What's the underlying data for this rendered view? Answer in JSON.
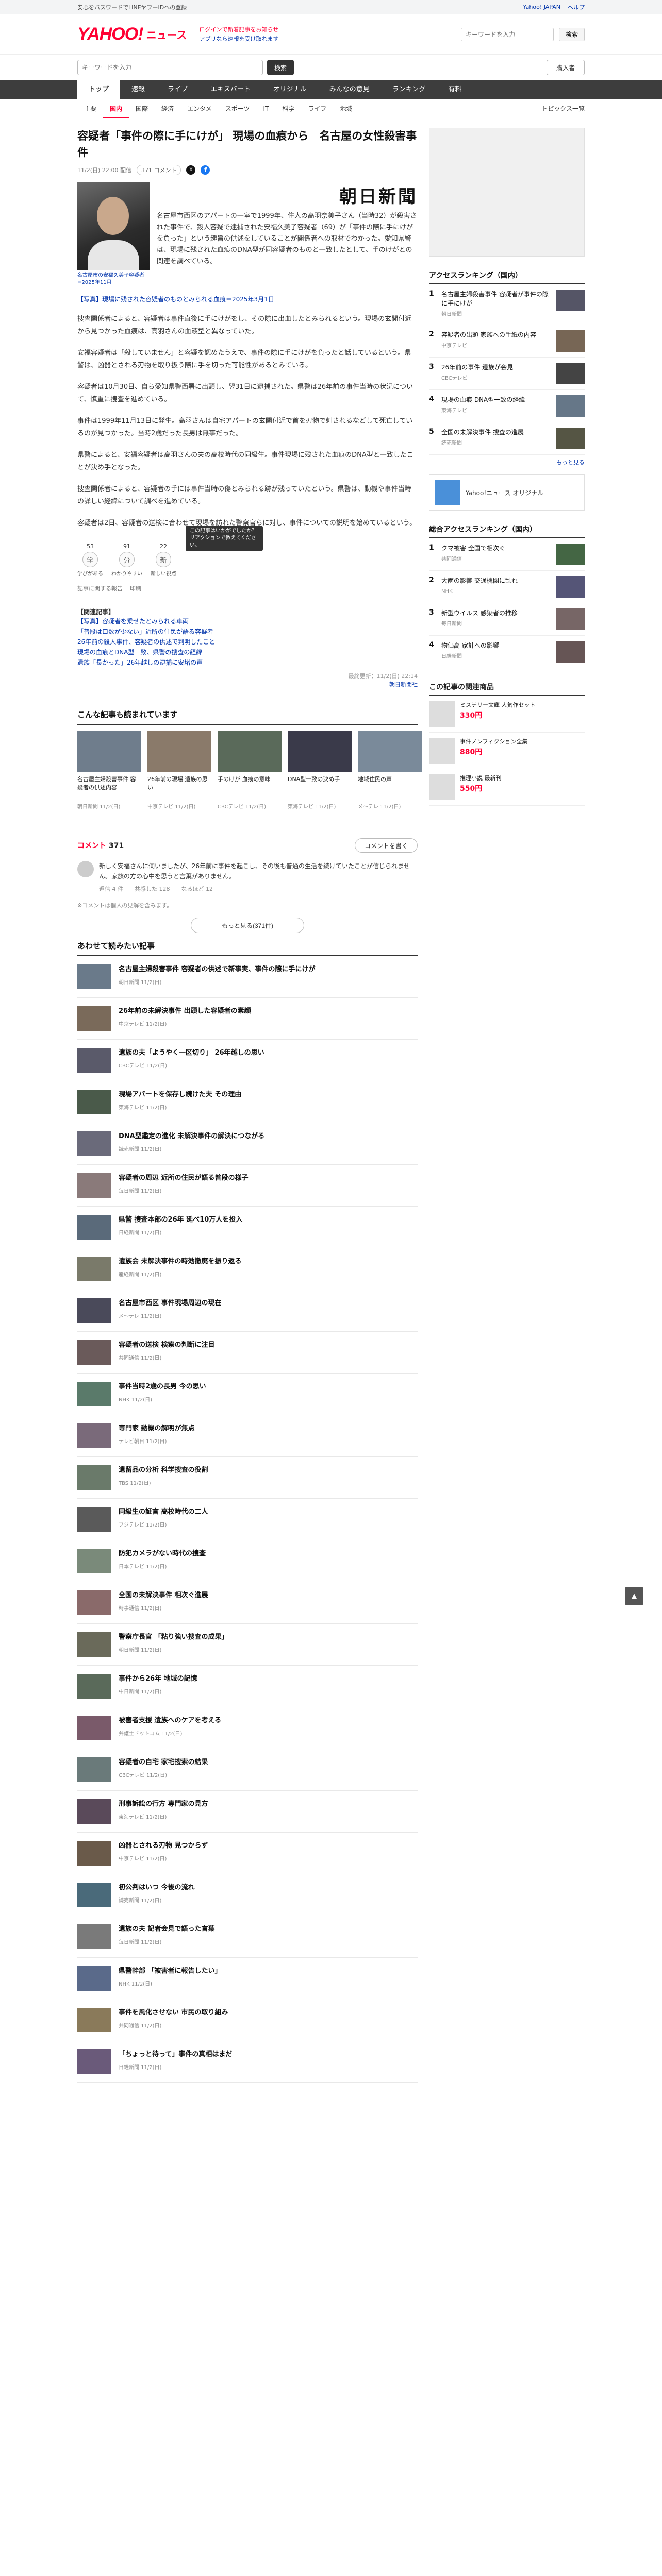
{
  "topbar": {
    "left": "安心をパスワードでLINEヤフーIDへの登録",
    "links": [
      "Yahoo! JAPAN",
      "ヘルプ"
    ]
  },
  "header": {
    "logo": "YAHOO!",
    "logo_sub": "ニュース",
    "notes": [
      "ログインで新着記事をお知らせ",
      "アプリなら速報を受け取れます"
    ],
    "search_placeholder": "キーワードを入力",
    "search_button": "検索"
  },
  "search": {
    "placeholder": "キーワードを入力",
    "button": "検索",
    "login": "購入者"
  },
  "nav": {
    "items": [
      "トップ",
      "速報",
      "ライブ",
      "エキスパート",
      "オリジナル",
      "みんなの意見",
      "ランキング",
      "有料"
    ],
    "active_index": 0,
    "right": "トピックス一覧"
  },
  "subnav": {
    "items": [
      "主要",
      "国内",
      "国際",
      "経済",
      "エンタメ",
      "スポーツ",
      "IT",
      "科学",
      "ライフ",
      "地域"
    ],
    "active_index": 1,
    "right": "トピックス一覧"
  },
  "article": {
    "headline": "容疑者「事件の際に手にけが」 現場の血痕から　名古屋の女性殺害事件",
    "date": "11/2(日) 22:00 配信",
    "comments_pill": "371 コメント",
    "paper": "朝日新聞",
    "photo_caption": "名古屋市の安福久美子容疑者=2025年11月",
    "lead": "名古屋市西区のアパートの一室で1999年、住人の高羽奈美子さん（当時32）が殺害された事件で、殺人容疑で逮捕された安福久美子容疑者（69）が「事件の際に手にけがを負った」という趣旨の供述をしていることが関係者への取材でわかった。愛知県警は、現場に残された血痕のDNA型が同容疑者のものと一致したとして、手のけがとの関連を調べている。",
    "photo_link": "【写真】現場に残された容疑者のものとみられる血痕＝2025年3月1日",
    "paragraphs": [
      "捜査関係者によると、容疑者は事件直後に手にけがをし、その際に出血したとみられるという。現場の玄関付近から見つかった血痕は、高羽さんの血液型と異なっていた。",
      "安福容疑者は「殺していません」と容疑を認めたうえで、事件の際に手にけがを負ったと話しているという。県警は、凶器とされる刃物を取り扱う際に手を切った可能性があるとみている。",
      "容疑者は10月30日、自ら愛知県警西署に出頭し、翌31日に逮捕された。県警は26年前の事件当時の状況について、慎重に捜査を進めている。",
      "事件は1999年11月13日に発生。高羽さんは自宅アパートの玄関付近で首を刃物で刺されるなどして死亡しているのが見つかった。当時2歳だった長男は無事だった。",
      "県警によると、安福容疑者は高羽さんの夫の高校時代の同級生。事件現場に残された血痕のDNA型と一致したことが決め手となった。",
      "捜査関係者によると、容疑者の手には事件当時の傷とみられる跡が残っていたという。県警は、動機や事件当時の詳しい経緯について調べを進めている。",
      "容疑者は2日、容疑者の送検に合わせて現場を訪れた警察官らに対し、事件についての説明を始めているという。"
    ],
    "reactions": [
      {
        "icon": "学",
        "label": "学びがある",
        "count": "53"
      },
      {
        "icon": "分",
        "label": "わかりやすい",
        "count": "91"
      },
      {
        "icon": "新",
        "label": "新しい視点",
        "count": "22"
      }
    ],
    "tooltip": "この記事はいかがでしたか？リアクションで教えてください。",
    "share": [
      "記事に関する報告",
      "印刷"
    ],
    "related_label": "【関連記事】",
    "related": [
      "【写真】容疑者を乗せたとみられる車両",
      "「普段は口数が少ない」近所の住民が語る容疑者",
      "26年前の殺人事件、容疑者の供述で判明したこと",
      "現場の血痕とDNA型一致、県警の捜査の経緯",
      "遺族「長かった」26年越しの逮捕に安堵の声"
    ],
    "source_line": "最終更新：11/2(日) 22:14",
    "more_link": "朝日新聞社"
  },
  "recommend": {
    "title": "こんな記事も読まれています",
    "cards": [
      {
        "title": "名古屋主婦殺害事件 容疑者の供述内容",
        "src": "朝日新聞 11/2(日)",
        "color": "#6f7d8c"
      },
      {
        "title": "26年前の現場 遺族の思い",
        "src": "中京テレビ 11/2(日)",
        "color": "#8a7a6a"
      },
      {
        "title": "手のけが 血痕の意味",
        "src": "CBCテレビ 11/2(日)",
        "color": "#5a6a5a"
      },
      {
        "title": "DNA型一致の決め手",
        "src": "東海テレビ 11/2(日)",
        "color": "#3a3a4a"
      },
      {
        "title": "地域住民の声",
        "src": "メ〜テレ 11/2(日)",
        "color": "#7a8a9a"
      }
    ]
  },
  "comments": {
    "label": "コメント",
    "count": "371",
    "write": "コメントを書く",
    "item_text": "新しく安福さんに伺いましたが、26年前に事件を起こし、その後も普通の生活を続けていたことが信じられません。家族の方の心中を思うと言葉がありません。",
    "item_meta": "返信 4 件　　共感した 128　　なるほど 12",
    "note": "※コメントは個人の見解を含みます。",
    "more": "もっと見る(371件)"
  },
  "side": {
    "ranking_title": "アクセスランキング（国内）",
    "ranking_sub": "",
    "ranking": [
      {
        "text": "名古屋主婦殺害事件 容疑者が事件の際に手にけが",
        "src": "朝日新聞",
        "color": "#556"
      },
      {
        "text": "容疑者の出頭 家族への手紙の内容",
        "src": "中京テレビ",
        "color": "#765"
      },
      {
        "text": "26年前の事件 遺族が会見",
        "src": "CBCテレビ",
        "color": "#444"
      },
      {
        "text": "現場の血痕 DNA型一致の経緯",
        "src": "東海テレビ",
        "color": "#678"
      },
      {
        "text": "全国の未解決事件 捜査の進展",
        "src": "読売新聞",
        "color": "#554"
      }
    ],
    "more": "もっと見る",
    "banner": "Yahoo!ニュース オリジナル",
    "ranking2_title": "総合アクセスランキング（国内）",
    "ranking2": [
      {
        "text": "クマ被害 全国で相次ぐ",
        "src": "共同通信",
        "color": "#464"
      },
      {
        "text": "大雨の影響 交通機関に乱れ",
        "src": "NHK",
        "color": "#557"
      },
      {
        "text": "新型ウイルス 感染者の推移",
        "src": "毎日新聞",
        "color": "#766"
      },
      {
        "text": "物価高 家計への影響",
        "src": "日経新聞",
        "color": "#655"
      }
    ],
    "shop_title": "この記事の関連商品",
    "shop": [
      {
        "text": "ミステリー文庫 人気作セット",
        "price": "330円"
      },
      {
        "text": "事件ノンフィクション全集",
        "price": "880円"
      },
      {
        "text": "推理小説 最新刊",
        "price": "550円"
      }
    ]
  },
  "latest": {
    "title": "あわせて読みたい記事",
    "items": [
      {
        "title": "名古屋主婦殺害事件 容疑者の供述で新事実、事件の際に手にけが",
        "src": "朝日新聞 11/2(日)",
        "color": "#6a7a8a"
      },
      {
        "title": "26年前の未解決事件 出頭した容疑者の素顔",
        "src": "中京テレビ 11/2(日)",
        "color": "#7a6a5a"
      },
      {
        "title": "遺族の夫「ようやく一区切り」 26年越しの思い",
        "src": "CBCテレビ 11/2(日)",
        "color": "#5a5a6a"
      },
      {
        "title": "現場アパートを保存し続けた夫 その理由",
        "src": "東海テレビ 11/2(日)",
        "color": "#4a5a4a"
      },
      {
        "title": "DNA型鑑定の進化 未解決事件の解決につながる",
        "src": "読売新聞 11/2(日)",
        "color": "#6a6a7a"
      },
      {
        "title": "容疑者の周辺 近所の住民が語る普段の様子",
        "src": "毎日新聞 11/2(日)",
        "color": "#8a7a7a"
      },
      {
        "title": "県警 捜査本部の26年 延べ10万人を投入",
        "src": "日経新聞 11/2(日)",
        "color": "#5a6a7a"
      },
      {
        "title": "遺族会 未解決事件の時効撤廃を振り返る",
        "src": "産経新聞 11/2(日)",
        "color": "#7a7a6a"
      },
      {
        "title": "名古屋市西区 事件現場周辺の現在",
        "src": "メ〜テレ 11/2(日)",
        "color": "#4a4a5a"
      },
      {
        "title": "容疑者の送検 検察の判断に注目",
        "src": "共同通信 11/2(日)",
        "color": "#6a5a5a"
      },
      {
        "title": "事件当時2歳の長男 今の思い",
        "src": "NHK 11/2(日)",
        "color": "#5a7a6a"
      },
      {
        "title": "専門家 動機の解明が焦点",
        "src": "テレビ朝日 11/2(日)",
        "color": "#7a6a7a"
      },
      {
        "title": "遺留品の分析 科学捜査の役割",
        "src": "TBS 11/2(日)",
        "color": "#6a7a6a"
      },
      {
        "title": "同級生の証言 高校時代の二人",
        "src": "フジテレビ 11/2(日)",
        "color": "#5a5a5a"
      },
      {
        "title": "防犯カメラがない時代の捜査",
        "src": "日本テレビ 11/2(日)",
        "color": "#7a8a7a"
      },
      {
        "title": "全国の未解決事件 相次ぐ進展",
        "src": "時事通信 11/2(日)",
        "color": "#8a6a6a"
      },
      {
        "title": "警察庁長官 「粘り強い捜査の成果」",
        "src": "朝日新聞 11/2(日)",
        "color": "#6a6a5a"
      },
      {
        "title": "事件から26年 地域の記憶",
        "src": "中日新聞 11/2(日)",
        "color": "#5a6a5a"
      },
      {
        "title": "被害者支援 遺族へのケアを考える",
        "src": "弁護士ドットコム 11/2(日)",
        "color": "#7a5a6a"
      },
      {
        "title": "容疑者の自宅 家宅捜索の結果",
        "src": "CBCテレビ 11/2(日)",
        "color": "#6a7a7a"
      },
      {
        "title": "刑事訴訟の行方 専門家の見方",
        "src": "東海テレビ 11/2(日)",
        "color": "#5a4a5a"
      },
      {
        "title": "凶器とされる刃物 見つからず",
        "src": "中京テレビ 11/2(日)",
        "color": "#6a5a4a"
      },
      {
        "title": "初公判はいつ 今後の流れ",
        "src": "読売新聞 11/2(日)",
        "color": "#4a6a7a"
      },
      {
        "title": "遺族の夫 記者会見で語った言葉",
        "src": "毎日新聞 11/2(日)",
        "color": "#7a7a7a"
      },
      {
        "title": "県警幹部 「被害者に報告したい」",
        "src": "NHK 11/2(日)",
        "color": "#5a6a8a"
      },
      {
        "title": "事件を風化させない 市民の取り組み",
        "src": "共同通信 11/2(日)",
        "color": "#8a7a5a"
      },
      {
        "title": "「ちょっと待って」事件の真相はまだ",
        "src": "日経新聞 11/2(日)",
        "color": "#6a5a7a"
      }
    ]
  }
}
